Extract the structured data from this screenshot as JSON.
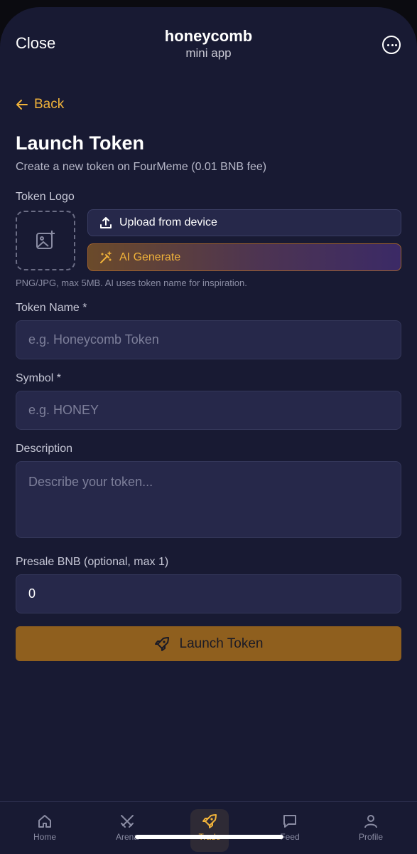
{
  "topbar": {
    "close": "Close",
    "title": "honeycomb",
    "subtitle": "mini app",
    "more_icon": "more-icon"
  },
  "back": "Back",
  "page": {
    "title": "Launch Token",
    "subtitle": "Create a new token on FourMeme (0.01 BNB fee)"
  },
  "logo": {
    "label": "Token Logo",
    "upload": "Upload from device",
    "ai": "AI Generate",
    "hint": "PNG/JPG, max 5MB. AI uses token name for inspiration."
  },
  "fields": {
    "name": {
      "label": "Token Name *",
      "placeholder": "e.g. Honeycomb Token"
    },
    "symbol": {
      "label": "Symbol *",
      "placeholder": "e.g. HONEY"
    },
    "description": {
      "label": "Description",
      "placeholder": "Describe your token..."
    },
    "presale": {
      "label": "Presale BNB (optional, max 1)",
      "value": "0"
    }
  },
  "launch": "Launch Token",
  "tabs": [
    {
      "label": "Home",
      "icon": "home-icon"
    },
    {
      "label": "Arena",
      "icon": "crossed-swords-icon"
    },
    {
      "label": "Trade",
      "icon": "rocket-icon"
    },
    {
      "label": "Feed",
      "icon": "chat-bubble-icon"
    },
    {
      "label": "Profile",
      "icon": "user-icon"
    }
  ],
  "active_tab": "Trade",
  "colors": {
    "accent": "#f0b23a",
    "background": "#181a33",
    "field": "#26284a",
    "launch_button": "#8f5f1e"
  }
}
